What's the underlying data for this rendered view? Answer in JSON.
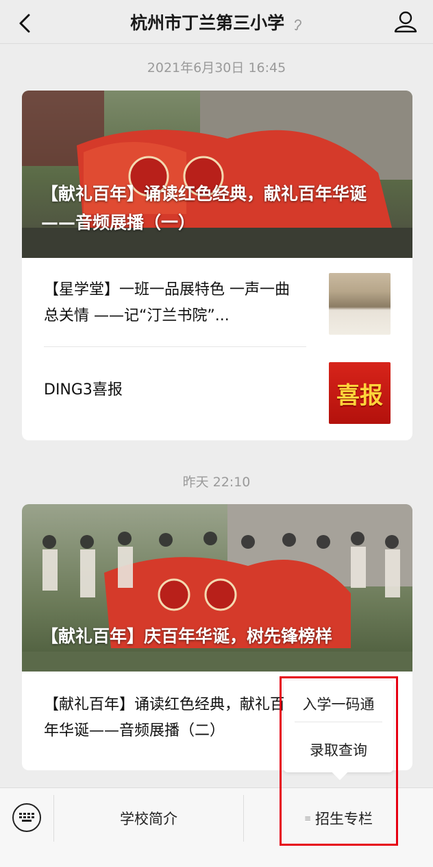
{
  "header": {
    "title": "杭州市丁兰第三小学",
    "back_icon": "back-arrow-icon",
    "profile_icon": "person-icon"
  },
  "messages": [
    {
      "timestamp": "2021年6月30日 16:45",
      "cover_title": "【献礼百年】诵读红色经典，献礼百年华诞——音频展播（一）",
      "articles": [
        {
          "title": "【星学堂】一班一品展特色 一声一曲总关情 ——记“汀兰书院”...",
          "thumb": "classroom-photo"
        },
        {
          "title": "DING3喜报",
          "thumb_text": "喜报"
        }
      ]
    },
    {
      "timestamp": "昨天 22:10",
      "cover_title": "【献礼百年】庆百年华诞，树先锋榜样",
      "articles": [
        {
          "title": "【献礼百年】诵读红色经典，献礼百年华诞——音频展播（二）"
        }
      ]
    }
  ],
  "bottom_menu": {
    "keyboard_icon": "keyboard-icon",
    "items": [
      "学校简介",
      "",
      "招生专栏"
    ]
  },
  "popup_menu": {
    "items": [
      "入学一码通",
      "录取查询"
    ]
  },
  "colors": {
    "highlight": "#e60012",
    "background": "#ededed"
  }
}
